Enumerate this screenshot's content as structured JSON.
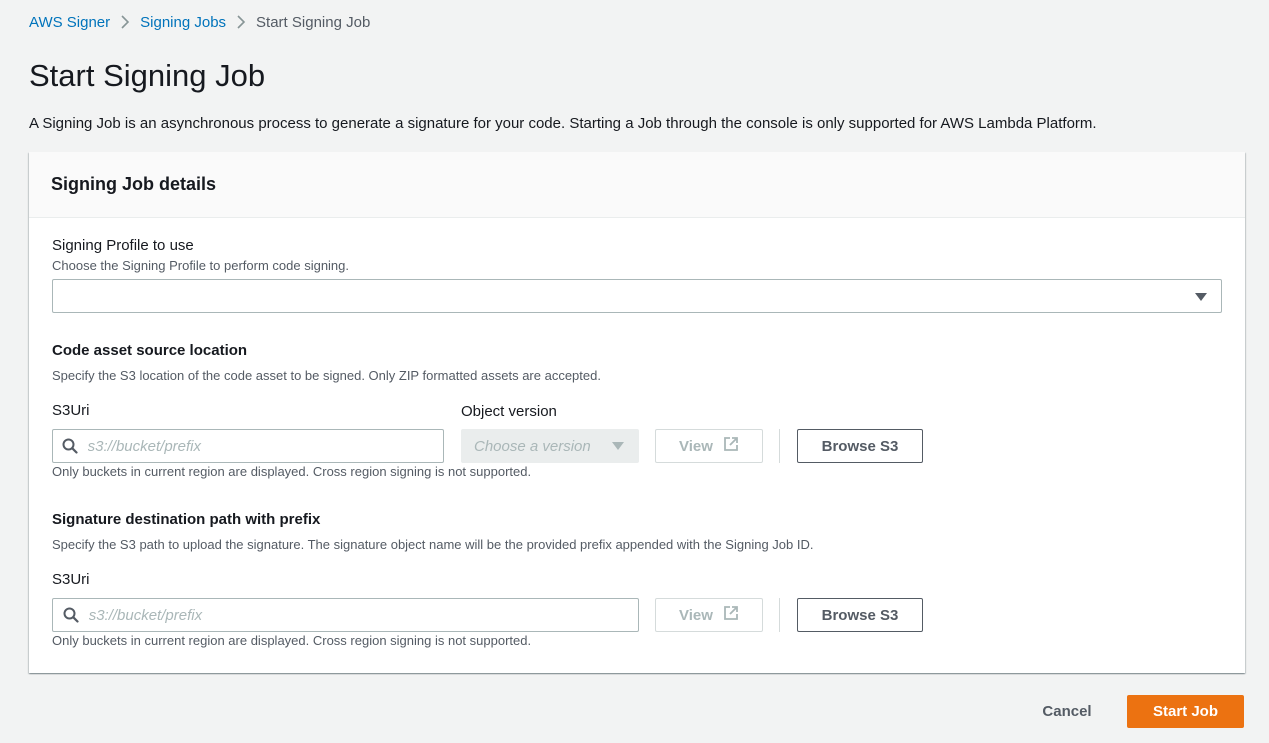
{
  "breadcrumb": {
    "items": [
      "AWS Signer",
      "Signing Jobs"
    ],
    "current": "Start Signing Job"
  },
  "page": {
    "title": "Start Signing Job",
    "description": "A Signing Job is an asynchronous process to generate a signature for your code. Starting a Job through the console is only supported for AWS Lambda Platform."
  },
  "panel": {
    "title": "Signing Job details"
  },
  "signing_profile": {
    "label": "Signing Profile to use",
    "hint": "Choose the Signing Profile to perform code signing.",
    "value": ""
  },
  "code_asset": {
    "title": "Code asset source location",
    "hint": "Specify the S3 location of the code asset to be signed. Only ZIP formatted assets are accepted.",
    "s3uri_label": "S3Uri",
    "s3uri_placeholder": "s3://bucket/prefix",
    "object_version_label": "Object version",
    "object_version_placeholder": "Choose a version",
    "view_label": "View",
    "browse_label": "Browse S3",
    "note": "Only buckets in current region are displayed. Cross region signing is not supported."
  },
  "signature_dest": {
    "title": "Signature destination path with prefix",
    "hint": "Specify the S3 path to upload the signature. The signature object name will be the provided prefix appended with the Signing Job ID.",
    "s3uri_label": "S3Uri",
    "s3uri_placeholder": "s3://bucket/prefix",
    "view_label": "View",
    "browse_label": "Browse S3",
    "note": "Only buckets in current region are displayed. Cross region signing is not supported."
  },
  "footer": {
    "cancel_label": "Cancel",
    "start_label": "Start Job"
  },
  "colors": {
    "accent": "#ec7211",
    "link": "#0073bb",
    "background": "#f2f3f3"
  }
}
